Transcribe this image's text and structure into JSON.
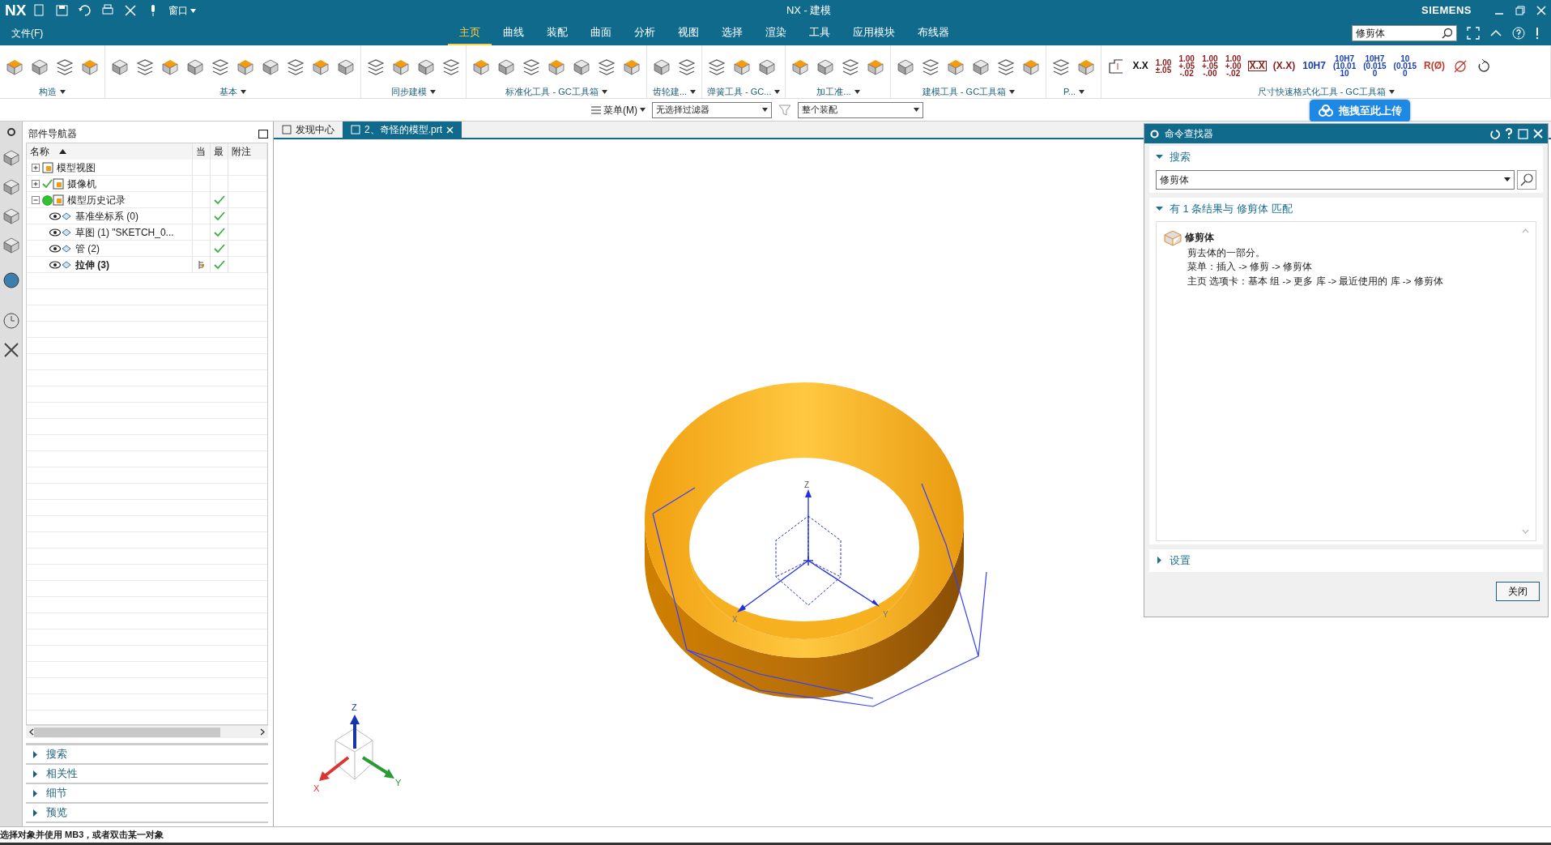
{
  "title_bar": {
    "app": "NX",
    "window_menu": "窗口",
    "title": "NX - 建模",
    "brand": "SIEMENS"
  },
  "menu": {
    "file": "文件(F)",
    "tabs": [
      {
        "label": "主页",
        "selected": true
      },
      {
        "label": "曲线",
        "selected": false
      },
      {
        "label": "装配",
        "selected": false
      },
      {
        "label": "曲面",
        "selected": false
      },
      {
        "label": "分析",
        "selected": false
      },
      {
        "label": "视图",
        "selected": false
      },
      {
        "label": "选择",
        "selected": false
      },
      {
        "label": "渲染",
        "selected": false
      },
      {
        "label": "工具",
        "selected": false
      },
      {
        "label": "应用模块",
        "selected": false
      },
      {
        "label": "布线器",
        "selected": false
      }
    ],
    "search": {
      "value": "修剪体"
    }
  },
  "ribbon": {
    "groups": [
      {
        "label": "构造",
        "dropdown": true
      },
      {
        "label": "基本",
        "dropdown": true
      },
      {
        "label": "同步建模",
        "dropdown": true
      },
      {
        "label": "标准化工具 - GC工具箱",
        "dropdown": true
      },
      {
        "label": "齿轮建...",
        "dropdown": true
      },
      {
        "label": "弹簧工具 - GC...",
        "dropdown": true
      },
      {
        "label": "加工准...",
        "dropdown": true
      },
      {
        "label": "建模工具 - GC工具箱",
        "dropdown": true
      },
      {
        "label": "P...",
        "dropdown": true
      },
      {
        "label": "尺寸快速格式化工具 - GC工具箱",
        "dropdown": true
      }
    ],
    "dimension_buttons": [
      {
        "lines": [
          "X.X"
        ],
        "color": "#111111"
      },
      {
        "lines": [
          "1.00",
          "±.05"
        ],
        "color": "#8b1a1a"
      },
      {
        "lines": [
          "1.00",
          "+.05",
          "-.02"
        ],
        "color": "#8b1a1a"
      },
      {
        "lines": [
          "1.00",
          "+.05",
          "-.00"
        ],
        "color": "#8b1a1a"
      },
      {
        "lines": [
          "1.00",
          "+.00",
          "-.02"
        ],
        "color": "#8b1a1a"
      },
      {
        "lines": [
          "X.X"
        ],
        "color": "#8b1a1a",
        "boxed": true
      },
      {
        "lines": [
          "(X.X)"
        ],
        "color": "#8b1a1a"
      },
      {
        "lines": [
          "10H7"
        ],
        "color": "#1a3fb0"
      },
      {
        "lines": [
          "10H7",
          "(10.01",
          "10"
        ],
        "color": "#1a3fb0"
      },
      {
        "lines": [
          "10H7",
          "(0.015",
          "0"
        ],
        "color": "#1a3fb0"
      },
      {
        "lines": [
          "10",
          "(0.015",
          "0"
        ],
        "color": "#1a3fb0"
      },
      {
        "lines": [
          "R(Ø)"
        ],
        "color": "#c0392b"
      }
    ]
  },
  "filter_bar": {
    "menu": "菜单(M)",
    "selection_filter": "无选择过滤器",
    "scope": "整个装配"
  },
  "upload_widget": {
    "label": "拖拽至此上传"
  },
  "document_tabs": [
    {
      "label": "发现中心",
      "selected": false
    },
    {
      "label": "2、奇怪的模型.prt",
      "selected": true
    }
  ],
  "part_navigator": {
    "title": "部件导航器",
    "columns": [
      {
        "label": "名称",
        "sorted": true
      },
      {
        "label": "当",
        "sorted": false
      },
      {
        "label": "最",
        "sorted": false
      },
      {
        "label": "附注",
        "sorted": false
      }
    ],
    "tree": [
      {
        "name": "模型视图",
        "expanded": false,
        "up_to_date": false,
        "current": false
      },
      {
        "name": "摄像机",
        "expanded": false,
        "visible_check": true,
        "up_to_date": false,
        "current": false
      },
      {
        "name": "模型历史记录",
        "expanded": true,
        "active": true,
        "up_to_date": true,
        "current": false,
        "children": [
          {
            "name": "基准坐标系 (0)",
            "up_to_date": true,
            "current": false
          },
          {
            "name": "草图 (1) \"SKETCH_0...",
            "up_to_date": true,
            "current": false
          },
          {
            "name": "管 (2)",
            "up_to_date": true,
            "current": false
          },
          {
            "name": "拉伸 (3)",
            "up_to_date": true,
            "current": true
          }
        ]
      }
    ],
    "panels": [
      {
        "label": "搜索",
        "expanded": false
      },
      {
        "label": "相关性",
        "expanded": false
      },
      {
        "label": "细节",
        "expanded": false
      },
      {
        "label": "预览",
        "expanded": false
      }
    ]
  },
  "viewport": {
    "datum_labels": [
      "Z",
      "X",
      "Y"
    ],
    "triad_labels": [
      "Z",
      "X",
      "Y"
    ]
  },
  "command_finder": {
    "title": "命令查找器",
    "sections": [
      {
        "label": "搜索",
        "expanded": true
      },
      {
        "label": "有 1 条结果与 修剪体 匹配",
        "expanded": true
      },
      {
        "label": "设置",
        "expanded": false
      }
    ],
    "search_value": "修剪体",
    "result": {
      "name": "修剪体",
      "lines": [
        "剪去体的一部分。",
        "菜单：插入 -> 修剪 -> 修剪体",
        "主页 选项卡：基本 组 -> 更多 库 -> 最近使用的 库 -> 修剪体"
      ]
    },
    "close_button": "关闭"
  },
  "status_bar": {
    "message": "选择对象并使用 MB3，或者双击某一对象"
  }
}
